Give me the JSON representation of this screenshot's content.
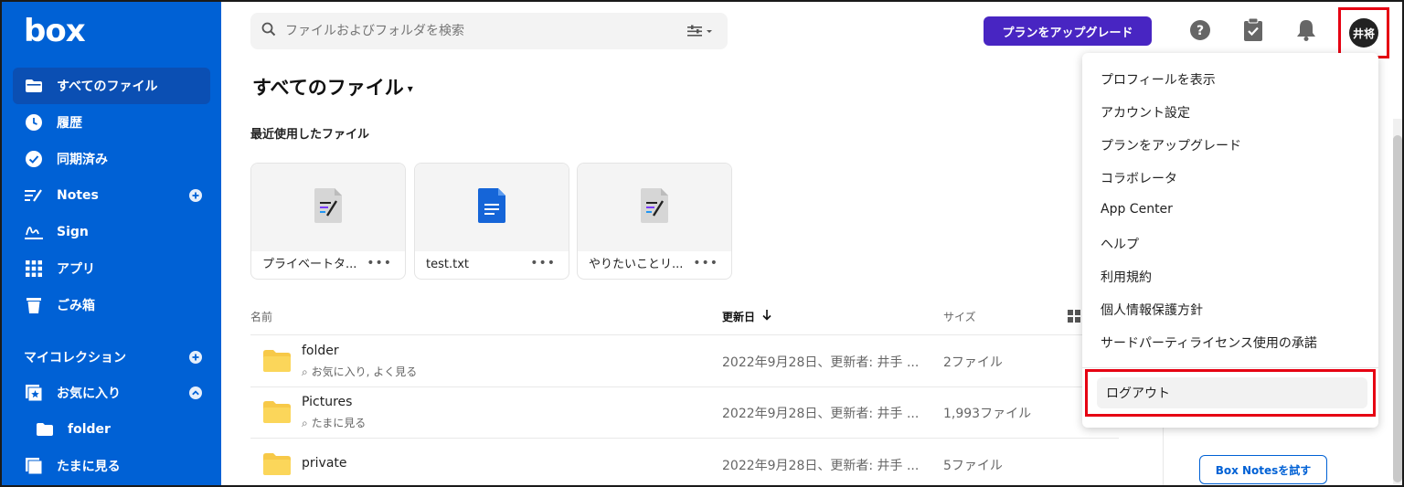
{
  "brand": {
    "logo": "box"
  },
  "sidebar": {
    "items": [
      {
        "label": "すべてのファイル",
        "icon": "folder-icon"
      },
      {
        "label": "履歴",
        "icon": "clock-icon"
      },
      {
        "label": "同期済み",
        "icon": "check-circle-icon"
      },
      {
        "label": "Notes",
        "icon": "notes-icon"
      },
      {
        "label": "Sign",
        "icon": "sign-icon"
      },
      {
        "label": "アプリ",
        "icon": "apps-grid-icon"
      },
      {
        "label": "ごみ箱",
        "icon": "trash-icon"
      }
    ],
    "collections_label": "マイコレクション",
    "favorites_label": "お気に入り",
    "favorites_child": "folder",
    "occasional_label": "たまに見る"
  },
  "search": {
    "placeholder": "ファイルおよびフォルダを検索"
  },
  "header": {
    "upgrade_label": "プランをアップグレード",
    "avatar_initials": "井将"
  },
  "main": {
    "title": "すべてのファイル",
    "recent_title": "最近使用したファイル",
    "recent_files": [
      {
        "name": "プライベートタ...",
        "type": "boxnote"
      },
      {
        "name": "test.txt",
        "type": "doc"
      },
      {
        "name": "やりたいことリ...",
        "type": "boxnote"
      }
    ],
    "more_label": "•••",
    "columns": {
      "name": "名前",
      "updated": "更新日",
      "size": "サイズ"
    },
    "rows": [
      {
        "name": "folder",
        "tag": "お気に入り, よく見る",
        "updated": "2022年9月28日、更新者: 井手 ...",
        "size": "2ファイル"
      },
      {
        "name": "Pictures",
        "tag": "たまに見る",
        "updated": "2022年9月28日、更新者: 井手 ...",
        "size": "1,993ファイル"
      },
      {
        "name": "private",
        "tag": "",
        "updated": "2022年9月28日、更新者: 井手 ...",
        "size": "5ファイル"
      }
    ]
  },
  "account_menu": {
    "items": [
      "プロフィールを表示",
      "アカウント設定",
      "プランをアップグレード",
      "コラボレータ",
      "App Center",
      "ヘルプ",
      "利用規約",
      "個人情報保護方針",
      "サードパーティライセンス使用の承諾"
    ],
    "logout": "ログアウト"
  },
  "right_panel": {
    "notes_button": "Box Notesを試す"
  },
  "colors": {
    "brand_blue": "#0061d5",
    "upgrade_purple": "#4825c2",
    "highlight_red": "#e60012"
  }
}
